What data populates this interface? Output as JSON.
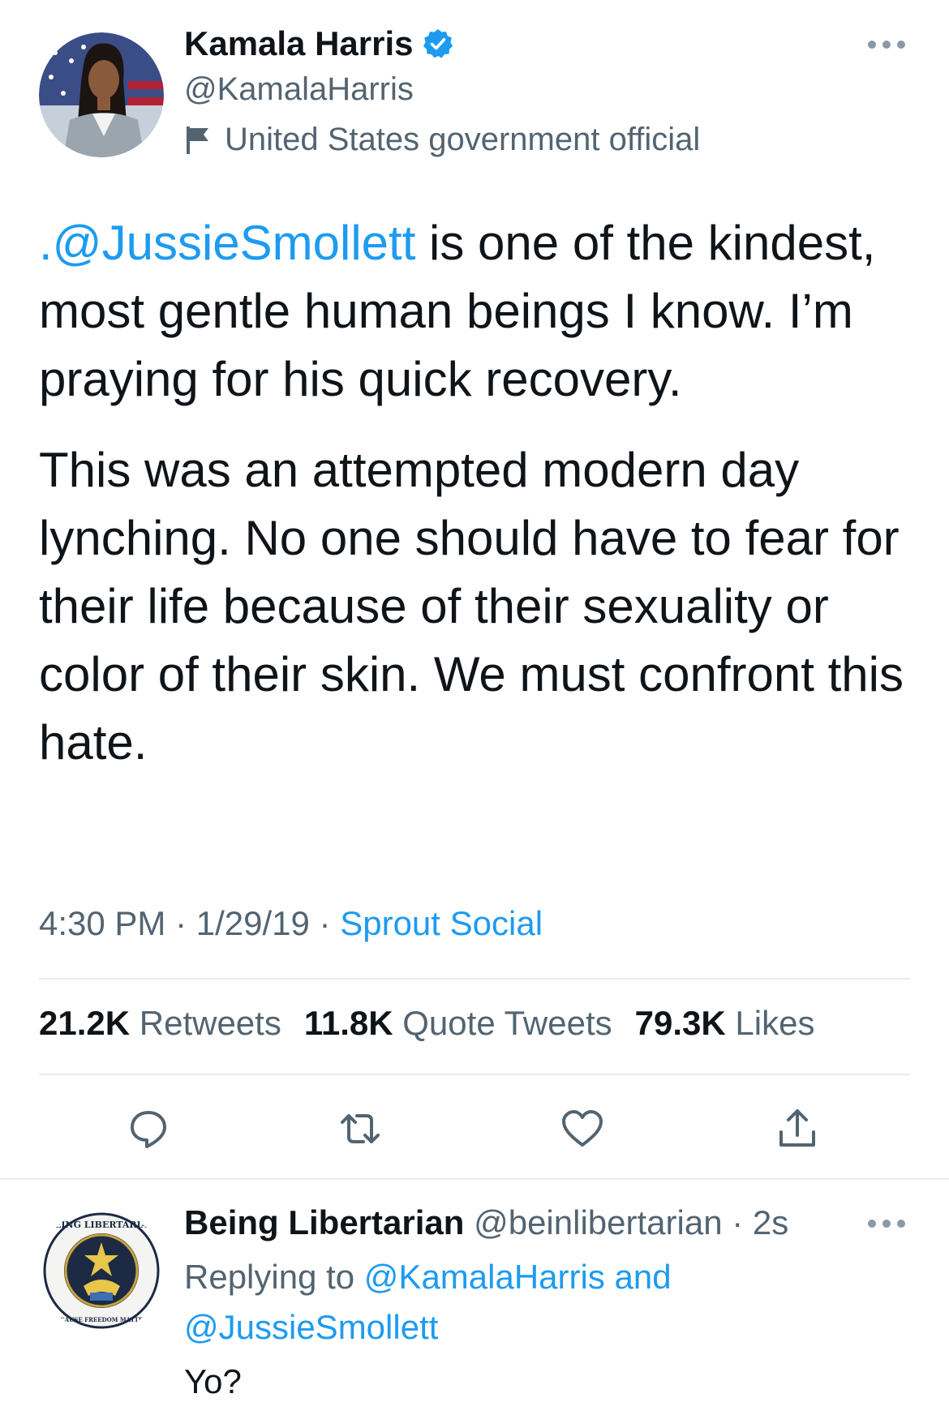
{
  "tweet": {
    "author_name": "Kamala Harris",
    "handle": "@KamalaHarris",
    "label": "United States government official",
    "mention": ".@JussieSmollett",
    "para1_rest": " is one of the kindest, most gentle human beings I know. I’m praying for his quick recovery.",
    "para2": "This was an attempted modern day lynching. No one should have to fear for their life because of their sexuality or color of their skin. We must confront this hate.",
    "time": "4:30 PM",
    "sep": " · ",
    "date": "1/29/19",
    "source": "Sprout Social"
  },
  "stats": {
    "retweets_count": "21.2K",
    "retweets_label": "Retweets",
    "quotes_count": "11.8K",
    "quotes_label": "Quote Tweets",
    "likes_count": "79.3K",
    "likes_label": "Likes"
  },
  "reply": {
    "author_name": "Being Libertarian",
    "handle": "@beinlibertarian",
    "sep": " · ",
    "time": "2s",
    "replying_to_label": "Replying to",
    "replying_to_users": "@KamalaHarris and @JussieSmollett",
    "text": "Yo?",
    "logo_text_top": "BEING LIBERTARIAN",
    "logo_text_bottom": "BECAUSE FREEDOM MATTERS"
  },
  "icons": {
    "verified": "verified-badge-icon",
    "flag": "flag-icon",
    "more": "more-icon",
    "reply": "reply-icon",
    "retweet": "retweet-icon",
    "like": "heart-icon",
    "share": "share-icon"
  },
  "colors": {
    "accent": "#1d9bf0",
    "text": "#0f1419",
    "secondary": "#536471",
    "divider": "#e6ecf0"
  }
}
